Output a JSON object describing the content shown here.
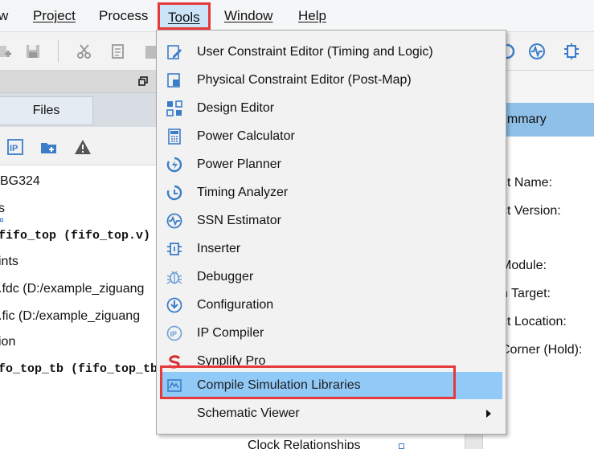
{
  "menubar": {
    "items": [
      {
        "label": "w",
        "mnemonic": ""
      },
      {
        "label": "Project",
        "mnemonic": "P"
      },
      {
        "label": "Process",
        "mnemonic": ""
      },
      {
        "label": "Tools",
        "mnemonic": "T"
      },
      {
        "label": "Window",
        "mnemonic": "W"
      },
      {
        "label": "Help",
        "mnemonic": "H"
      }
    ]
  },
  "left_panel": {
    "tab_label": "Files",
    "tree": [
      "BG324",
      "s",
      "fifo_top (fifo_top.v)",
      "ints",
      ".fdc (D:/example_ziguang",
      ".fic (D:/example_ziguang",
      "ion",
      "fo_top_tb (fifo_top_tb"
    ]
  },
  "right_panel": {
    "tab_label": "ummary",
    "labels": [
      "ct Name:",
      "ct Version:",
      "Module:",
      "n Target:",
      "ct Location:",
      "Corner (Hold):"
    ],
    "clock_relationships": "Clock Relationships"
  },
  "tools_menu": {
    "items": [
      {
        "name": "user-constraint-editor",
        "label": "User Constraint Editor (Timing and Logic)",
        "icon": "pencil-doc-icon"
      },
      {
        "name": "physical-constraint-editor",
        "label": "Physical Constraint Editor (Post-Map)",
        "icon": "chip-doc-icon"
      },
      {
        "name": "design-editor",
        "label": "Design Editor",
        "icon": "design-grid-icon"
      },
      {
        "name": "power-calculator",
        "label": "Power Calculator",
        "icon": "calculator-icon"
      },
      {
        "name": "power-planner",
        "label": "Power Planner",
        "icon": "power-swirl-icon"
      },
      {
        "name": "timing-analyzer",
        "label": "Timing Analyzer",
        "icon": "clock-icon"
      },
      {
        "name": "ssn-estimator",
        "label": "SSN Estimator",
        "icon": "wave-circle-icon"
      },
      {
        "name": "inserter",
        "label": "Inserter",
        "icon": "inserter-chip-icon"
      },
      {
        "name": "debugger",
        "label": "Debugger",
        "icon": "bug-icon"
      },
      {
        "name": "configuration",
        "label": "Configuration",
        "icon": "download-circle-icon"
      },
      {
        "name": "ip-compiler",
        "label": "IP Compiler",
        "icon": "ip-circle-icon"
      },
      {
        "name": "synplify-pro",
        "label": "Synplify Pro",
        "icon": "synplify-logo-icon"
      },
      {
        "name": "compile-simulation-libraries",
        "label": "Compile Simulation Libraries",
        "icon": "sim-library-icon"
      },
      {
        "name": "schematic-viewer",
        "label": "Schematic Viewer",
        "icon": ""
      }
    ],
    "highlighted": "Compile Simulation Libraries"
  },
  "colors": {
    "highlight": "#91c9f7",
    "annotation_red": "#e5393b",
    "icon_blue": "#3c7dc9"
  }
}
